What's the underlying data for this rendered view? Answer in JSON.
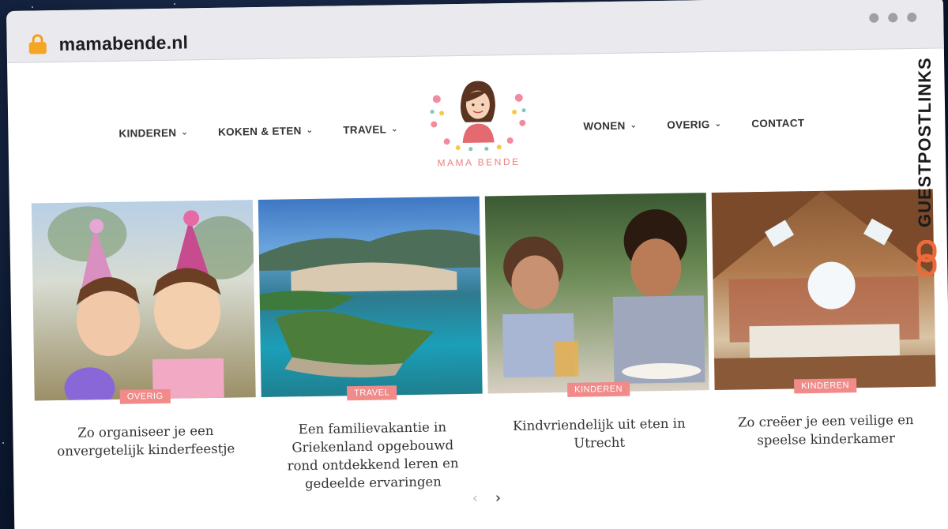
{
  "browser": {
    "url": "mamabende.nl"
  },
  "nav": {
    "left": [
      {
        "label": "KINDEREN",
        "has_dropdown": true
      },
      {
        "label": "KOKEN & ETEN",
        "has_dropdown": true
      },
      {
        "label": "TRAVEL",
        "has_dropdown": true
      }
    ],
    "right": [
      {
        "label": "WONEN",
        "has_dropdown": true
      },
      {
        "label": "OVERIG",
        "has_dropdown": true
      },
      {
        "label": "CONTACT",
        "has_dropdown": false
      }
    ]
  },
  "logo": {
    "text": "MAMA BENDE"
  },
  "cards": [
    {
      "category": "OVERIG",
      "title": "Zo organiseer je een onvergetelijk kinderfeestje"
    },
    {
      "category": "TRAVEL",
      "title": "Een familievakantie in Griekenland opgebouwd rond ontdekkend leren en gedeelde ervaringen"
    },
    {
      "category": "KINDEREN",
      "title": "Kindvriendelijk uit eten in Utrecht"
    },
    {
      "category": "KINDEREN",
      "title": "Zo creëer je een veilige en speelse kinderkamer"
    }
  ],
  "pager": {
    "prev": "‹",
    "next": "›"
  },
  "watermark": {
    "text": "GUESTPOSTLINKS"
  },
  "colors": {
    "accent": "#f08b89",
    "logo_text": "#e8817f",
    "brand_icon": "#ef6a3a"
  }
}
